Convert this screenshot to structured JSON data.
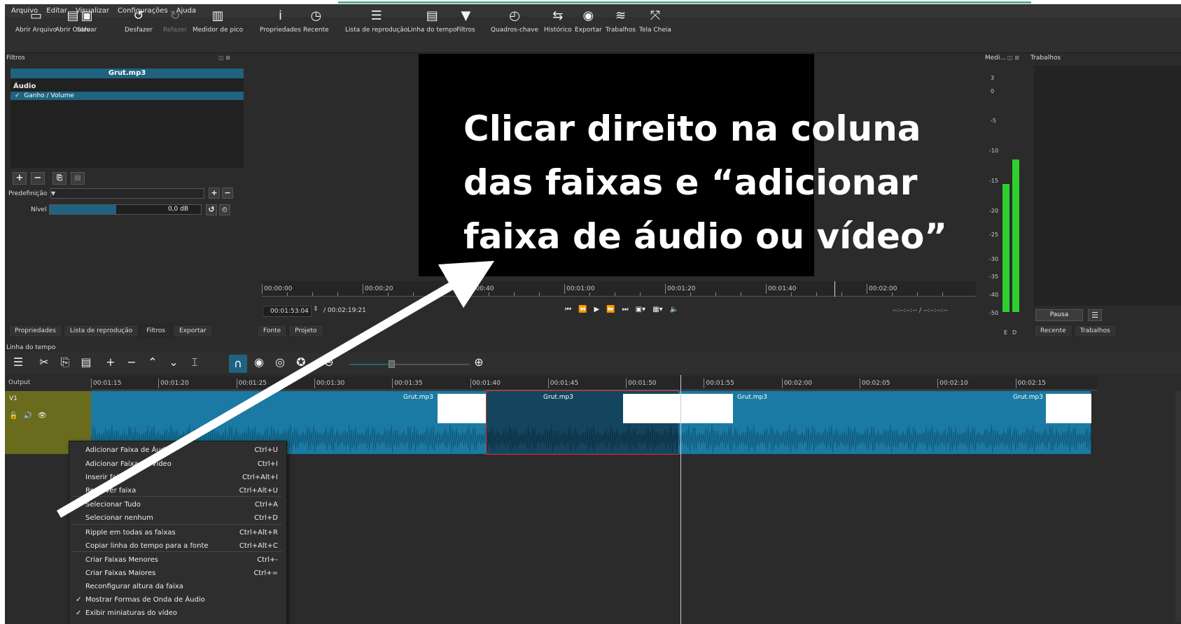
{
  "menu": [
    "Arquivo",
    "Editar",
    "Visualizar",
    "Configurações",
    "Ajuda"
  ],
  "toolbar": [
    {
      "label": "Abrir Arquivo",
      "icon": "open-folder-icon",
      "glyph": "▭"
    },
    {
      "label": "Abrir Outro",
      "icon": "open-other-icon",
      "glyph": "▤"
    },
    {
      "label": "Salvar",
      "icon": "save-icon",
      "glyph": "▣"
    },
    {
      "label": "Desfazer",
      "icon": "undo-icon",
      "glyph": "↺"
    },
    {
      "label": "Refazer",
      "icon": "redo-icon",
      "glyph": "↻"
    },
    {
      "label": "Medidor de pico",
      "icon": "peak-meter-icon",
      "glyph": "▥"
    },
    {
      "label": "Propriedades",
      "icon": "info-icon",
      "glyph": "i"
    },
    {
      "label": "Recente",
      "icon": "clock-icon",
      "glyph": "◷"
    },
    {
      "label": "Lista de reprodução",
      "icon": "playlist-icon",
      "glyph": "☰"
    },
    {
      "label": "Linha do tempo",
      "icon": "timeline-icon",
      "glyph": "▤"
    },
    {
      "label": "Filtros",
      "icon": "filter-icon",
      "glyph": "▼"
    },
    {
      "label": "Quadros-chave",
      "icon": "stopwatch-icon",
      "glyph": "◴"
    },
    {
      "label": "Histórico",
      "icon": "history-icon",
      "glyph": "⇆"
    },
    {
      "label": "Exportar",
      "icon": "export-disc-icon",
      "glyph": "◉"
    },
    {
      "label": "Trabalhos",
      "icon": "jobs-stack-icon",
      "glyph": "≋"
    },
    {
      "label": "Tela Cheia",
      "icon": "fullscreen-icon",
      "glyph": "⤧"
    }
  ],
  "filters": {
    "title": "Filtros",
    "clip_name": "Grut.mp3",
    "section": "Áudio",
    "item": "Ganho / Volume",
    "preset_label": "Predefinição",
    "level_label": "Nível",
    "level_value": "0,0 dB",
    "level_fraction": 0.44
  },
  "left_tabs": [
    "Propriedades",
    "Lista de reprodução",
    "Filtros",
    "Exportar"
  ],
  "player": {
    "ruler_ticks": [
      "00:00:00",
      "00:00:20",
      "00:00:40",
      "00:01:00",
      "00:01:20",
      "00:01:40",
      "00:02:00"
    ],
    "current_time": "00:01:53:04",
    "total_time": "/ 00:02:19:21",
    "in_out": "--:--:--:-- /     --:--:--:--",
    "tabs": [
      "Fonte",
      "Projeto"
    ]
  },
  "meter": {
    "title": "Medi...",
    "scale": [
      "3",
      "0",
      "-5",
      "-10",
      "-15",
      "-20",
      "-25",
      "-30",
      "-35",
      "-40",
      "-50"
    ],
    "channels": [
      "E",
      "D"
    ],
    "left_level_db": -16,
    "right_level_db": -12
  },
  "jobs": {
    "title": "Trabalhos",
    "pause_label": "Pausa",
    "tabs": [
      "Recente",
      "Trabalhos"
    ]
  },
  "timeline": {
    "title": "Linha do tempo",
    "output_label": "Output",
    "track_name": "V1",
    "ruler_ticks": [
      "00:01:15",
      "00:01:20",
      "00:01:25",
      "00:01:30",
      "00:01:35",
      "00:01:40",
      "00:01:45",
      "00:01:50",
      "00:01:55",
      "00:02:00",
      "00:02:05",
      "00:02:10",
      "00:02:15"
    ],
    "clip_label": "Grut.mp3"
  },
  "context_menu": [
    {
      "label": "Adicionar Faixa de Áudio",
      "shortcut": "Ctrl+U",
      "check": ""
    },
    {
      "label": "Adicionar Faixa de Vídeo",
      "shortcut": "Ctrl+I",
      "check": ""
    },
    {
      "label": "Inserir faixa",
      "shortcut": "Ctrl+Alt+I",
      "check": ""
    },
    {
      "label": "Remover faixa",
      "shortcut": "Ctrl+Alt+U",
      "check": ""
    },
    {
      "label": "Selecionar Tudo",
      "shortcut": "Ctrl+A",
      "check": ""
    },
    {
      "label": "Selecionar nenhum",
      "shortcut": "Ctrl+D",
      "check": ""
    },
    {
      "label": "Ripple em todas as faixas",
      "shortcut": "Ctrl+Alt+R",
      "check": ""
    },
    {
      "label": "Copiar linha do tempo para a fonte",
      "shortcut": "Ctrl+Alt+C",
      "check": ""
    },
    {
      "label": "Criar Faixas Menores",
      "shortcut": "Ctrl+-",
      "check": ""
    },
    {
      "label": "Criar Faixas Maiores",
      "shortcut": "Ctrl+=",
      "check": ""
    },
    {
      "label": "Reconfigurar altura da faixa",
      "shortcut": "",
      "check": ""
    },
    {
      "label": "Mostrar Formas de Onda de Áudio",
      "shortcut": "",
      "check": "✓"
    },
    {
      "label": "Exibir miniaturas do vídeo",
      "shortcut": "",
      "check": "✓"
    }
  ],
  "annotation": {
    "line1": "Clicar direito na coluna",
    "line2": "das faixas e “adicionar",
    "line3": "faixa de áudio ou vídeo”"
  },
  "colors": {
    "accent": "#1f6380",
    "clip": "#1b7aa3",
    "track_header": "#6b6b1e",
    "meter": "#2dd02d"
  }
}
